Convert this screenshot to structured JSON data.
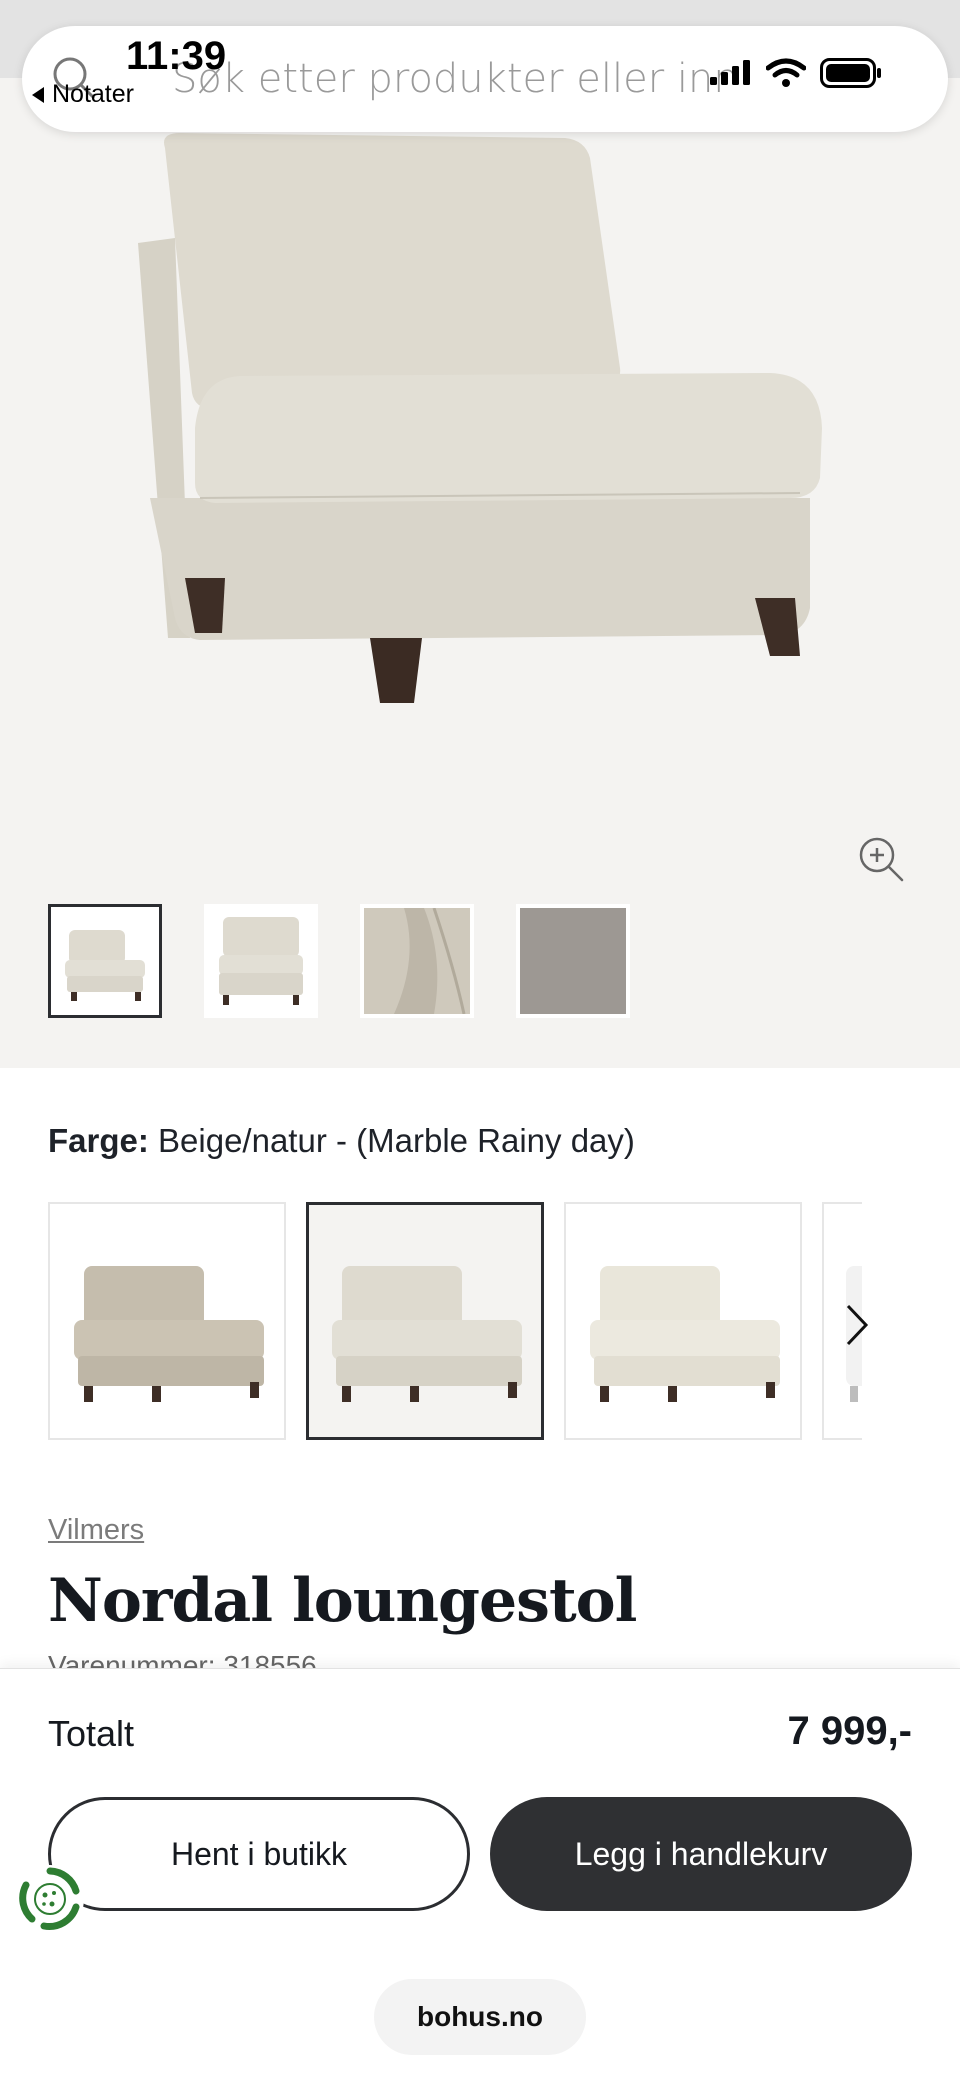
{
  "status_bar": {
    "time": "11:39",
    "back_label": "Notater"
  },
  "search": {
    "placeholder": "Søk etter produkter eller innhold..."
  },
  "gallery": {
    "thumbnail_count": 4,
    "active_index": 0
  },
  "color": {
    "label": "Farge:",
    "value": "Beige/natur - (Marble Rainy day)",
    "active_swatch": 1
  },
  "product": {
    "brand": "Vilmers",
    "title": "Nordal loungestol",
    "sku": "Varenummer: 318556"
  },
  "cart_bar": {
    "total_label": "Totalt",
    "total_price": "7 999,-",
    "store_button": "Hent i butikk",
    "cart_button": "Legg i handlekurv"
  },
  "browser": {
    "domain": "bohus.no"
  },
  "colors": {
    "accent_dark": "#2f3033",
    "hero_bg": "#f4f3f1",
    "fabric": "#dcd8cc"
  }
}
